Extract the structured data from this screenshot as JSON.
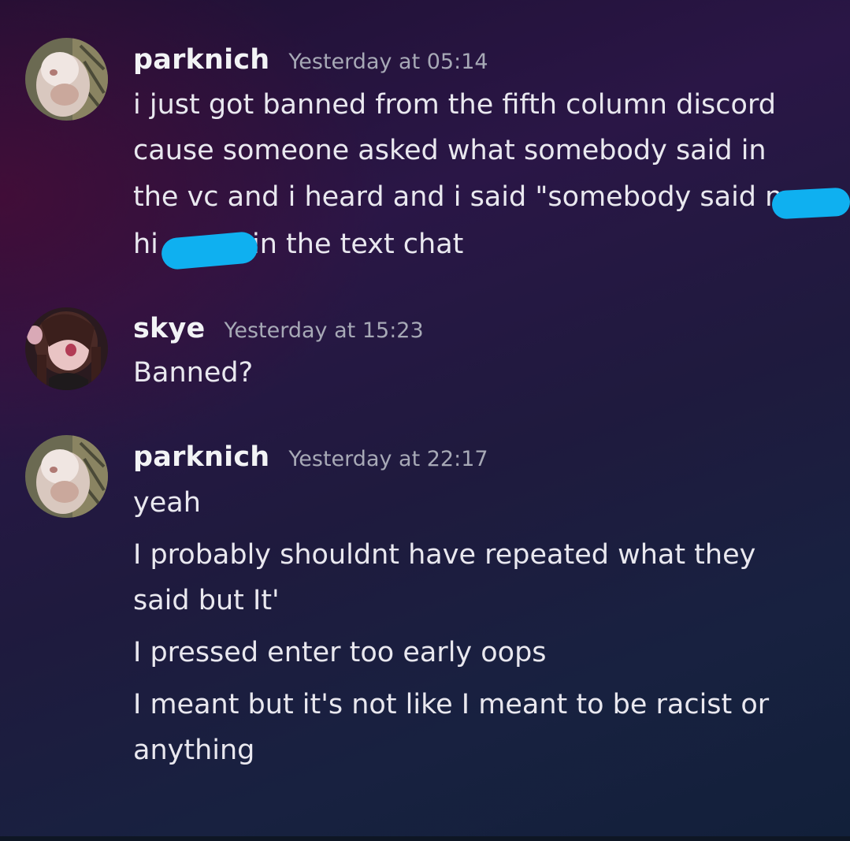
{
  "messages": [
    {
      "username": "parknich",
      "timestamp": "Yesterday at 05:14",
      "avatar": "avatar-parknich",
      "lines": [
        "i just got banned from the fifth column discord",
        "cause someone asked what somebody said in",
        "the vc and i heard and i said \"somebody said n",
        "hi",
        "in the text chat"
      ]
    },
    {
      "username": "skye",
      "timestamp": "Yesterday at 15:23",
      "avatar": "avatar-skye",
      "lines": [
        "Banned?"
      ]
    },
    {
      "username": "parknich",
      "timestamp": "Yesterday at 22:17",
      "avatar": "avatar-parknich",
      "lines": [
        "yeah",
        "I probably shouldnt have repeated what they",
        "said but It'",
        "I pressed enter too early oops",
        "I meant but it's not like I meant to be racist or",
        "anything"
      ]
    }
  ],
  "colors": {
    "redaction": "#0fb0f0",
    "username": "#f2f3f5",
    "timestamp": "#a7a9b6",
    "text": "#e9e8ef"
  }
}
